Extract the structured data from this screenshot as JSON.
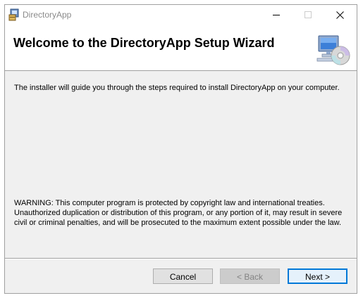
{
  "window": {
    "title": "DirectoryApp",
    "controls": {
      "minimize": "minimize-icon",
      "maximize": "maximize-icon",
      "close": "close-icon"
    }
  },
  "header": {
    "title": "Welcome to the DirectoryApp Setup Wizard",
    "icon": "computer-cd-icon"
  },
  "body": {
    "intro": "The installer will guide you through the steps required to install DirectoryApp on your computer.",
    "warning": "WARNING: This computer program is protected by copyright law and international treaties. Unauthorized duplication or distribution of this program, or any portion of it, may result in severe civil or criminal penalties, and will be prosecuted to the maximum extent possible under the law."
  },
  "buttons": {
    "cancel": "Cancel",
    "back": "< Back",
    "next": "Next >"
  },
  "colors": {
    "accent": "#0078d7",
    "dialog_bg": "#f0f0f0"
  }
}
